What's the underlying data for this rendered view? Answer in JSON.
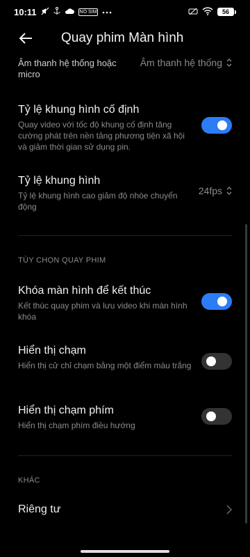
{
  "status_bar": {
    "time": "10:11",
    "left_icons": [
      "no-sound-icon",
      "anchor-icon",
      "cloud-icon",
      "badge-icon",
      "more-dots-icon"
    ],
    "badge_text": "NO SIM",
    "battery_level": "56"
  },
  "header": {
    "title": "Quay phim Màn hình"
  },
  "settings": {
    "sound_source": {
      "title": "Âm thanh hệ thống hoặc micro",
      "value": "Âm thanh hệ thống"
    },
    "fixed_frame_rate": {
      "title": "Tỷ lệ khung hình cố định",
      "description": "Quay video với tốc độ khung cố định tăng cường phát trên nền tảng phương tiện xã hội và giảm thời gian sử dụng pin.",
      "enabled": true
    },
    "frame_rate": {
      "title": "Tỷ lệ khung hình",
      "description": "Tỷ lệ khung hình cao giảm độ nhòe chuyển động",
      "value": "24fps"
    },
    "recording_options_label": "TÙY CHỌN QUAY PHIM",
    "lock_to_stop": {
      "title": "Khóa màn hình để kết thúc",
      "description": "Kết thúc quay phim và lưu video khi màn hình khóa",
      "enabled": true
    },
    "show_touches": {
      "title": "Hiển thị chạm",
      "description": "Hiển thị cử chỉ chạm bằng một điểm màu trắng",
      "enabled": false
    },
    "show_key_presses": {
      "title": "Hiển thị chạm phím",
      "description": "Hiển thị chạm phím điều hướng",
      "enabled": false
    },
    "other_label": "KHÁC",
    "privacy": {
      "title": "Riêng tư"
    }
  },
  "colors": {
    "background": "#000000",
    "accent": "#2c7cf6",
    "secondary_text": "#8b8b8b",
    "divider": "#222222"
  }
}
